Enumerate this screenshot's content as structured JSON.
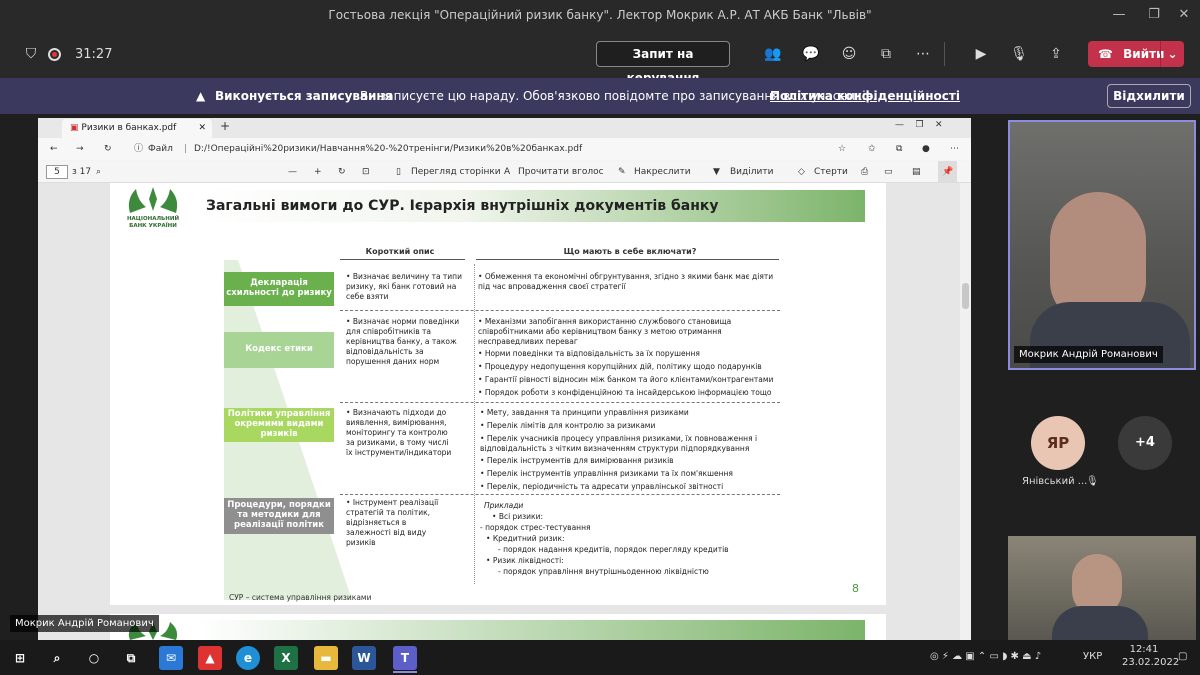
{
  "window": {
    "title": "Гостьова лекція \"Операційний ризик банку\". Лектор Мокрик А.Р. АТ АКБ Банк \"Львів\""
  },
  "meeting": {
    "timer": "31:27",
    "request_control": "Запит на керування",
    "leave": "Вийти"
  },
  "recording_banner": {
    "bold": "Виконується записування",
    "text": "Ви записуєте цю нараду. Обов'язково повідомте про записування всіх учасників.",
    "link": "Політика конфіденційності",
    "dismiss": "Відхилити"
  },
  "browser": {
    "tab_title": "Ризики в банках.pdf",
    "file_label": "Файл",
    "address": "D:/!Операційні%20ризики/Навчання%20-%20тренінги/Ризики%20в%20банках.pdf"
  },
  "pdf_toolbar": {
    "page_current": "5",
    "page_total": "з 17",
    "page_view": "Перегляд сторінки",
    "read_aloud": "Прочитати вголос",
    "draw": "Накреслити",
    "highlight": "Виділити",
    "erase": "Стерти"
  },
  "slide": {
    "logo_text": "НАЦІОНАЛЬНИЙ БАНК УКРАЇНИ",
    "title": "Загальні вимоги до СУР. Ієрархія внутрішніх документів банку",
    "col_short": "Короткий опис",
    "col_include": "Що мають в себе включати?",
    "rows": [
      {
        "label": "Декларація схильності до ризику",
        "desc": "Визначає величину та типи ризику, які банк готовий на себе взяти",
        "details": [
          "Обмеження та економічні обгрунтування, згідно з якими банк має діяти під час впровадження своєї стратегії"
        ]
      },
      {
        "label": "Кодекс етики",
        "desc": "Визначає норми поведінки для співробітників та керівництва банку, а також відповідальність за порушення даних норм",
        "details": [
          "Механізми запобігання використанню службового становища співробітниками або керівництвом банку з метою отримання несправедливих переваг",
          "Норми поведінки та відповідальність за їх порушення",
          "Процедуру недопущення корупційних дій, політику щодо подарунків",
          "Гарантії рівності відносин між банком та його клієнтами/контрагентами",
          "Порядок роботи з конфіденційною та інсайдерською інформацією тощо"
        ]
      },
      {
        "label": "Політики управління окремими видами ризиків",
        "desc": "Визначають підходи до виявлення, вимірювання, моніторингу та контролю за ризиками, в тому числі їх інструменти/індикатори",
        "details": [
          "Мету, завдання та принципи управління ризиками",
          "Перелік лімітів для контролю за ризиками",
          "Перелік учасників процесу управління ризиками, їх повноваження і відповідальність з чітким визначенням структури підпорядкування",
          "Перелік інструментів для вимірювання ризиків",
          "Перелік інструментів управління ризиками та їх пом'якшення",
          "Перелік, періодичність та адресати управлінської звітності"
        ]
      },
      {
        "label": "Процедури, порядки та методики для реалізації політик",
        "desc": "Інструмент реалізації стратегій та політик, відрізняється в залежності від виду ризиків",
        "details": [
          "Приклади",
          "Всі ризики:",
          "- порядок стрес-тестування",
          "Кредитний ризик:",
          "порядок надання кредитів, порядок перегляду кредитів",
          "Ризик ліквідності:",
          "порядок управління внутрішньоденною ліквідністю"
        ]
      }
    ],
    "footer": "СУР – система управління ризиками",
    "page_number": "8"
  },
  "participants": {
    "speaker_name": "Мокрик Андрій Романович",
    "shared_label": "Мокрик Андрій Романович",
    "avatar_initials": "ЯР",
    "avatar_name": "Янівський ...",
    "more_count": "+4"
  },
  "taskbar": {
    "lang": "УКР",
    "time": "12:41",
    "date": "23.02.2022"
  },
  "colors": {
    "accent": "#8b8bdf",
    "leave": "#c4314b",
    "green": "#7cb46a",
    "banner": "#3b3a5e"
  }
}
